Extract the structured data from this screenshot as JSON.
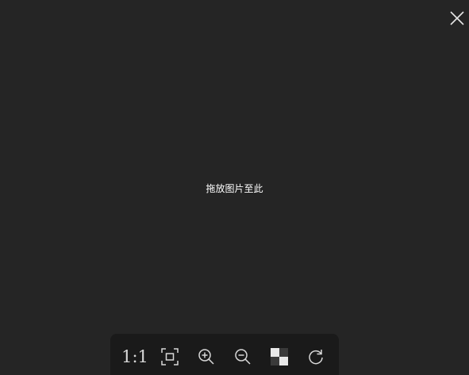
{
  "viewer": {
    "drop_hint": "拖放图片至此"
  },
  "window": {
    "close_icon": "close-icon"
  },
  "toolbar": {
    "actual_size_label": "1:1",
    "icons": {
      "fit": "fit-to-window-icon",
      "zoom_in": "zoom-in-icon",
      "zoom_out": "zoom-out-icon",
      "background": "checkerboard-background-icon",
      "rotate": "rotate-clockwise-icon"
    }
  },
  "colors": {
    "background": "#252525",
    "toolbar_background": "#1a1a1a",
    "icon": "#d8d8d8",
    "text": "#ffffff"
  }
}
